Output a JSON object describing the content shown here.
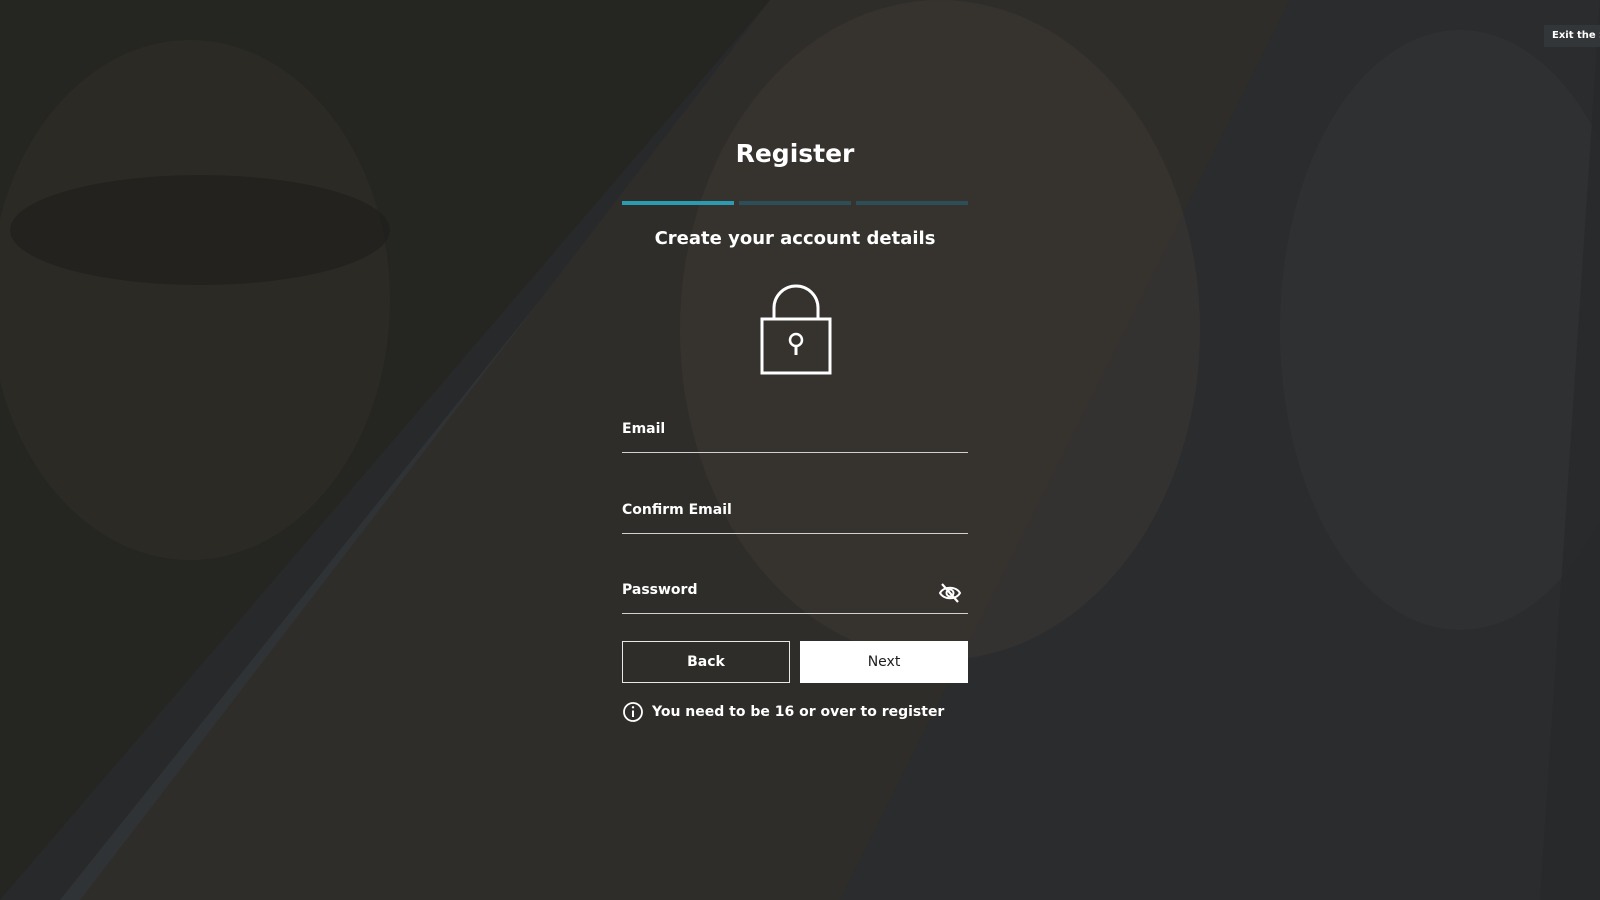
{
  "header": {
    "exit_label": "Exit the S"
  },
  "register": {
    "title": "Register",
    "progress": {
      "total_steps": 3,
      "current_step": 1
    },
    "subtitle": "Create your account details",
    "fields": {
      "email_label": "Email",
      "email_value": "",
      "confirm_email_label": "Confirm Email",
      "confirm_email_value": "",
      "password_label": "Password",
      "password_value": ""
    },
    "back_label": "Back",
    "next_label": "Next",
    "age_notice": "You need to be 16 or over to register"
  },
  "icons": {
    "lock": "lock-icon",
    "eye": "eye-slash-icon",
    "info": "info-circle-icon"
  },
  "colors": {
    "accent": "#2a9bb0",
    "progress_inactive": "#2b4e58",
    "background": "#2e3133"
  }
}
